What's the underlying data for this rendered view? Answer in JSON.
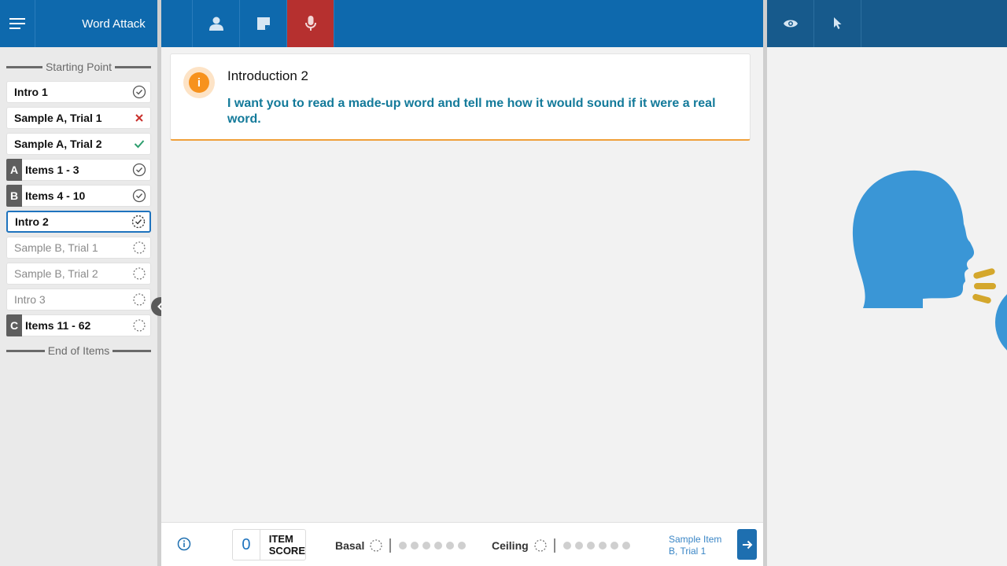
{
  "app": {
    "title": "Word Attack"
  },
  "toolbar": {
    "menu_icon": "hamburger-icon",
    "tools": [
      {
        "name": "examinee",
        "icon": "person-icon"
      },
      {
        "name": "notes",
        "icon": "note-icon"
      },
      {
        "name": "record",
        "icon": "microphone-icon",
        "active": true
      }
    ],
    "right_tools": [
      {
        "name": "view",
        "icon": "eye-icon"
      },
      {
        "name": "pointer",
        "icon": "cursor-icon"
      }
    ]
  },
  "sidebar": {
    "start_label": "Starting Point",
    "end_label": "End of Items",
    "items": [
      {
        "label": "Intro 1",
        "status": "complete"
      },
      {
        "label": "Sample A, Trial 1",
        "status": "incorrect"
      },
      {
        "label": "Sample A, Trial 2",
        "status": "correct"
      },
      {
        "label": "Items 1 - 3",
        "badge": "A",
        "status": "complete"
      },
      {
        "label": "Items 4 - 10",
        "badge": "B",
        "status": "complete"
      },
      {
        "label": "Intro 2",
        "status": "current"
      },
      {
        "label": "Sample B, Trial 1",
        "status": "pending"
      },
      {
        "label": "Sample B, Trial 2",
        "status": "pending"
      },
      {
        "label": "Intro 3",
        "status": "pending"
      },
      {
        "label": "Items 11 - 62",
        "badge": "C",
        "status": "pending"
      }
    ]
  },
  "instruction": {
    "title": "Introduction 2",
    "text": "I want you to read a made-up word and tell me how it would sound if it were a real word."
  },
  "footer": {
    "item_score_value": "0",
    "item_score_label_1": "ITEM",
    "item_score_label_2": "SCORE",
    "basal_label": "Basal",
    "ceiling_label": "Ceiling",
    "next_label_1": "Sample Item",
    "next_label_2": "B, Trial 1"
  },
  "colors": {
    "topbar": "#0e69ad",
    "record_active": "#b6302f",
    "accent_teal": "#137a9a",
    "head_blue": "#3a96d6",
    "sound_gold": "#d4a72c"
  }
}
